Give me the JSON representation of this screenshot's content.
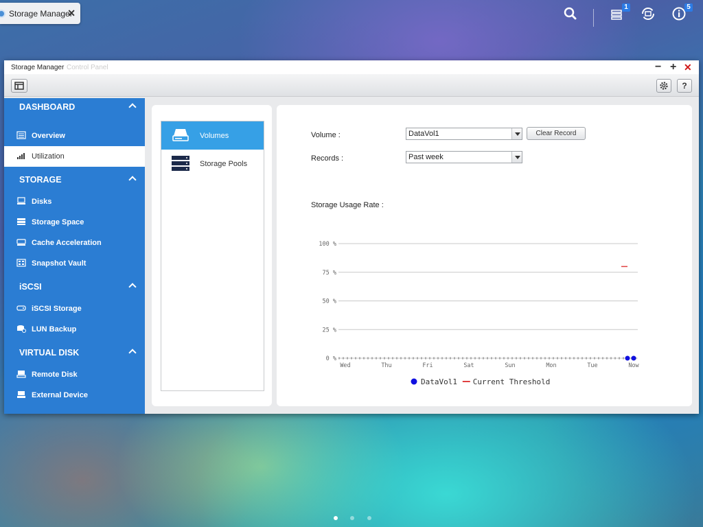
{
  "taskbar": {
    "app_tab_label": "Storage Manager",
    "notifications_badge": "1",
    "info_badge": "5",
    "icons": [
      "search-icon",
      "notifications-icon",
      "sync-icon",
      "info-icon"
    ]
  },
  "window": {
    "title": "Storage Manager",
    "subtitle": "Control Panel",
    "controls": [
      "−",
      "+",
      "✕"
    ]
  },
  "sidebar": {
    "sections": [
      {
        "label": "DASHBOARD",
        "items": [
          {
            "label": "Overview",
            "icon": "overview-icon"
          },
          {
            "label": "Utilization",
            "icon": "utilization-icon",
            "active": true
          }
        ]
      },
      {
        "label": "STORAGE",
        "items": [
          {
            "label": "Disks",
            "icon": "disk-icon"
          },
          {
            "label": "Storage Space",
            "icon": "storage-space-icon"
          },
          {
            "label": "Cache Acceleration",
            "icon": "cache-icon"
          },
          {
            "label": "Snapshot Vault",
            "icon": "snapshot-icon"
          }
        ]
      },
      {
        "label": "iSCSI",
        "items": [
          {
            "label": "iSCSI Storage",
            "icon": "iscsi-icon"
          },
          {
            "label": "LUN Backup",
            "icon": "lun-backup-icon"
          }
        ]
      },
      {
        "label": "VIRTUAL DISK",
        "items": [
          {
            "label": "Remote Disk",
            "icon": "remote-disk-icon"
          },
          {
            "label": "External Device",
            "icon": "external-device-icon"
          }
        ]
      }
    ]
  },
  "middle": {
    "items": [
      {
        "label": "Volumes",
        "active": true
      },
      {
        "label": "Storage Pools"
      }
    ]
  },
  "form": {
    "volume_label": "Volume :",
    "volume_value": "DataVol1",
    "clear_record": "Clear Record",
    "records_label": "Records :",
    "records_value": "Past week",
    "usage_label": "Storage Usage Rate :"
  },
  "colors": {
    "accent": "#2b7dd3",
    "active_item": "#36a0e6",
    "series": "#1010e0",
    "threshold": "#e04040"
  },
  "chart_data": {
    "type": "line",
    "categories": [
      "Wed",
      "Thu",
      "Fri",
      "Sat",
      "Sun",
      "Mon",
      "Tue",
      "Now"
    ],
    "y_ticks": [
      "0 %",
      "25 %",
      "50 %",
      "75 %",
      "100 %"
    ],
    "ylim": [
      0,
      100
    ],
    "series": [
      {
        "name": "DataVol1",
        "x": [
          6.85,
          7.0
        ],
        "values": [
          0,
          0
        ],
        "color": "#1010e0"
      },
      {
        "name": "Current Threshold",
        "x": [
          6.7,
          6.85
        ],
        "values": [
          80,
          80
        ],
        "color": "#e04040"
      }
    ],
    "grid": true,
    "legend": "bottom"
  },
  "pager": {
    "count": 3,
    "active": 0
  }
}
